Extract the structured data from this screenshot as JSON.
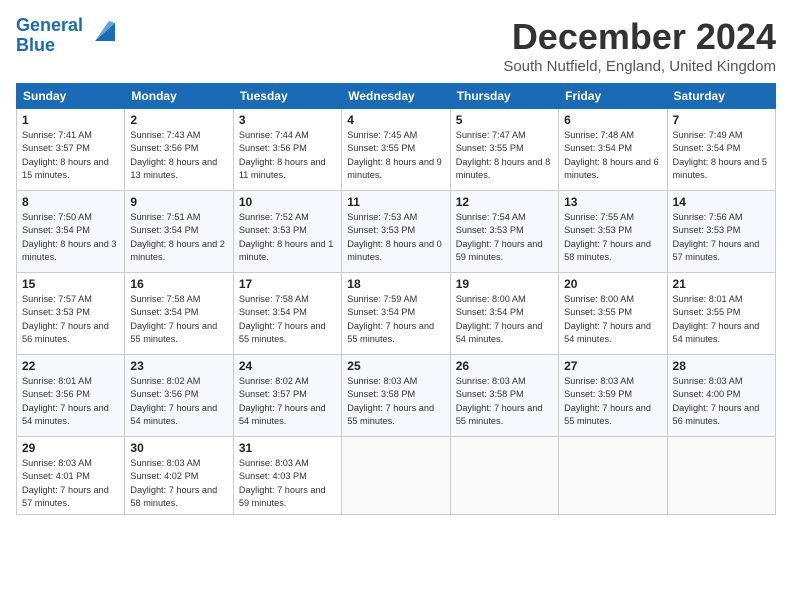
{
  "logo": {
    "line1": "General",
    "line2": "Blue"
  },
  "title": "December 2024",
  "subtitle": "South Nutfield, England, United Kingdom",
  "headers": [
    "Sunday",
    "Monday",
    "Tuesday",
    "Wednesday",
    "Thursday",
    "Friday",
    "Saturday"
  ],
  "weeks": [
    [
      {
        "num": "1",
        "rise": "7:41 AM",
        "set": "3:57 PM",
        "daylight": "8 hours and 15 minutes."
      },
      {
        "num": "2",
        "rise": "7:43 AM",
        "set": "3:56 PM",
        "daylight": "8 hours and 13 minutes."
      },
      {
        "num": "3",
        "rise": "7:44 AM",
        "set": "3:56 PM",
        "daylight": "8 hours and 11 minutes."
      },
      {
        "num": "4",
        "rise": "7:45 AM",
        "set": "3:55 PM",
        "daylight": "8 hours and 9 minutes."
      },
      {
        "num": "5",
        "rise": "7:47 AM",
        "set": "3:55 PM",
        "daylight": "8 hours and 8 minutes."
      },
      {
        "num": "6",
        "rise": "7:48 AM",
        "set": "3:54 PM",
        "daylight": "8 hours and 6 minutes."
      },
      {
        "num": "7",
        "rise": "7:49 AM",
        "set": "3:54 PM",
        "daylight": "8 hours and 5 minutes."
      }
    ],
    [
      {
        "num": "8",
        "rise": "7:50 AM",
        "set": "3:54 PM",
        "daylight": "8 hours and 3 minutes."
      },
      {
        "num": "9",
        "rise": "7:51 AM",
        "set": "3:54 PM",
        "daylight": "8 hours and 2 minutes."
      },
      {
        "num": "10",
        "rise": "7:52 AM",
        "set": "3:53 PM",
        "daylight": "8 hours and 1 minute."
      },
      {
        "num": "11",
        "rise": "7:53 AM",
        "set": "3:53 PM",
        "daylight": "8 hours and 0 minutes."
      },
      {
        "num": "12",
        "rise": "7:54 AM",
        "set": "3:53 PM",
        "daylight": "7 hours and 59 minutes."
      },
      {
        "num": "13",
        "rise": "7:55 AM",
        "set": "3:53 PM",
        "daylight": "7 hours and 58 minutes."
      },
      {
        "num": "14",
        "rise": "7:56 AM",
        "set": "3:53 PM",
        "daylight": "7 hours and 57 minutes."
      }
    ],
    [
      {
        "num": "15",
        "rise": "7:57 AM",
        "set": "3:53 PM",
        "daylight": "7 hours and 56 minutes."
      },
      {
        "num": "16",
        "rise": "7:58 AM",
        "set": "3:54 PM",
        "daylight": "7 hours and 55 minutes."
      },
      {
        "num": "17",
        "rise": "7:58 AM",
        "set": "3:54 PM",
        "daylight": "7 hours and 55 minutes."
      },
      {
        "num": "18",
        "rise": "7:59 AM",
        "set": "3:54 PM",
        "daylight": "7 hours and 55 minutes."
      },
      {
        "num": "19",
        "rise": "8:00 AM",
        "set": "3:54 PM",
        "daylight": "7 hours and 54 minutes."
      },
      {
        "num": "20",
        "rise": "8:00 AM",
        "set": "3:55 PM",
        "daylight": "7 hours and 54 minutes."
      },
      {
        "num": "21",
        "rise": "8:01 AM",
        "set": "3:55 PM",
        "daylight": "7 hours and 54 minutes."
      }
    ],
    [
      {
        "num": "22",
        "rise": "8:01 AM",
        "set": "3:56 PM",
        "daylight": "7 hours and 54 minutes."
      },
      {
        "num": "23",
        "rise": "8:02 AM",
        "set": "3:56 PM",
        "daylight": "7 hours and 54 minutes."
      },
      {
        "num": "24",
        "rise": "8:02 AM",
        "set": "3:57 PM",
        "daylight": "7 hours and 54 minutes."
      },
      {
        "num": "25",
        "rise": "8:03 AM",
        "set": "3:58 PM",
        "daylight": "7 hours and 55 minutes."
      },
      {
        "num": "26",
        "rise": "8:03 AM",
        "set": "3:58 PM",
        "daylight": "7 hours and 55 minutes."
      },
      {
        "num": "27",
        "rise": "8:03 AM",
        "set": "3:59 PM",
        "daylight": "7 hours and 55 minutes."
      },
      {
        "num": "28",
        "rise": "8:03 AM",
        "set": "4:00 PM",
        "daylight": "7 hours and 56 minutes."
      }
    ],
    [
      {
        "num": "29",
        "rise": "8:03 AM",
        "set": "4:01 PM",
        "daylight": "7 hours and 57 minutes."
      },
      {
        "num": "30",
        "rise": "8:03 AM",
        "set": "4:02 PM",
        "daylight": "7 hours and 58 minutes."
      },
      {
        "num": "31",
        "rise": "8:03 AM",
        "set": "4:03 PM",
        "daylight": "7 hours and 59 minutes."
      },
      null,
      null,
      null,
      null
    ]
  ]
}
